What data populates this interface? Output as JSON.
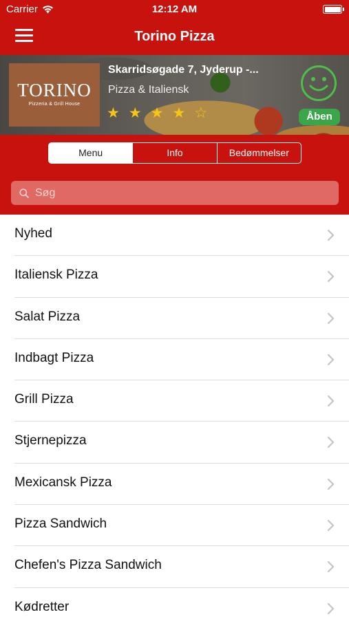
{
  "status_bar": {
    "carrier": "Carrier",
    "time": "12:12 AM"
  },
  "nav": {
    "title": "Torino Pizza"
  },
  "restaurant": {
    "logo_name": "TORINO",
    "logo_subtitle": "Pizzeria & Grill House",
    "address": "Skarridsøgade 7, Jyderup -...",
    "cuisine": "Pizza & Italiensk",
    "rating": 4,
    "rating_max": 5,
    "status": "Åben",
    "status_color": "#3aa64a"
  },
  "tabs": [
    "Menu",
    "Info",
    "Bedømmelser"
  ],
  "search": {
    "placeholder": "Søg"
  },
  "categories": [
    "Nyhed",
    "Italiensk Pizza",
    "Salat Pizza",
    "Indbagt Pizza",
    "Grill Pizza",
    "Stjernepizza",
    "Mexicansk Pizza",
    "Pizza Sandwich",
    "Chefen's Pizza Sandwich",
    "Kødretter"
  ],
  "colors": {
    "brand": "#c8120e",
    "star": "#f5c518"
  }
}
